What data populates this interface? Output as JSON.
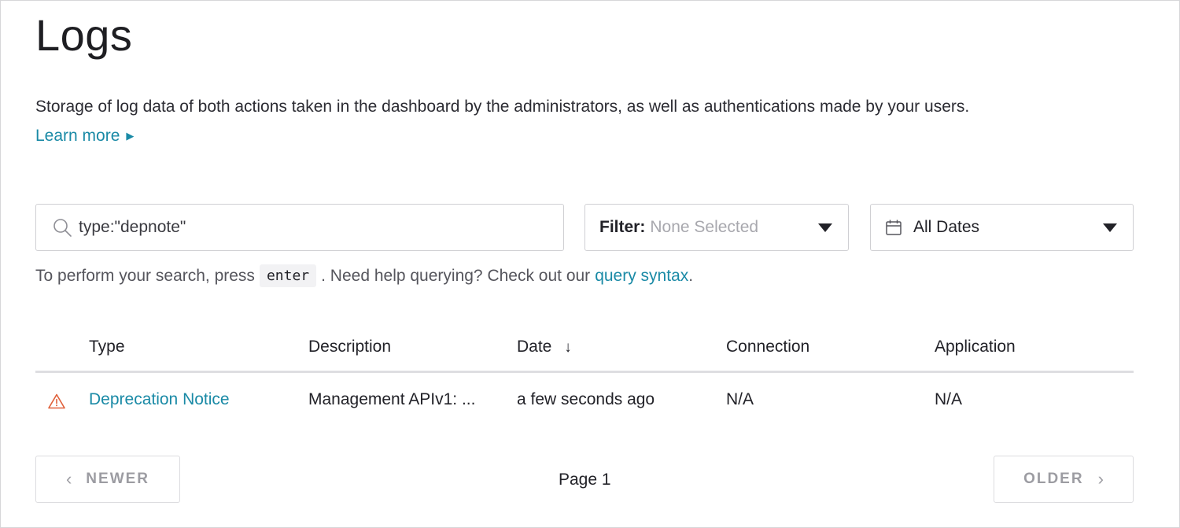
{
  "header": {
    "title": "Logs",
    "description": "Storage of log data of both actions taken in the dashboard by the administrators, as well as authentications made by your users.",
    "learn_more": "Learn more"
  },
  "search": {
    "value": "type:\"depnote\"",
    "icon": "search-icon"
  },
  "filter": {
    "label": "Filter:",
    "value": "None Selected"
  },
  "date_filter": {
    "value": "All Dates",
    "icon": "calendar-icon"
  },
  "hint": {
    "prefix": "To perform your search, press",
    "key": "enter",
    "middle": ". Need help querying? Check out our",
    "link": "query syntax",
    "suffix": "."
  },
  "table": {
    "columns": [
      "Type",
      "Description",
      "Date",
      "Connection",
      "Application"
    ],
    "sort_indicator": "↓",
    "rows": [
      {
        "icon": "warning-icon",
        "type": "Deprecation Notice",
        "description": "Management APIv1: ...",
        "date": "a few seconds ago",
        "connection": "N/A",
        "application": "N/A"
      }
    ]
  },
  "pagination": {
    "newer": "NEWER",
    "older": "OLDER",
    "page": "Page 1"
  },
  "colors": {
    "accent": "#1a8aa6",
    "warning": "#e0603a"
  }
}
